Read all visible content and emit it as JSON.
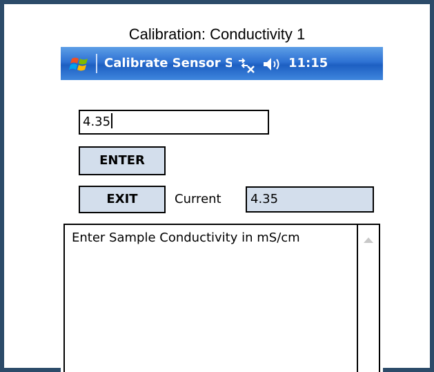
{
  "caption": "Calibration: Conductivity 1",
  "titlebar": {
    "start_icon": "windows-logo-icon",
    "title": "Calibrate Sensor S",
    "network_icon": "network-disconnected-icon",
    "speaker_icon": "speaker-icon",
    "time": "11:15",
    "colors": {
      "bar": "#2e72d3",
      "text": "#ffffff"
    }
  },
  "form": {
    "input_value": "4.35",
    "enter_label": "ENTER",
    "exit_label": "EXIT",
    "current_label": "Current",
    "current_value": "4.35",
    "button_color": "#d3deec"
  },
  "log": {
    "lines": [
      "Enter Sample Conductivity in mS/cm"
    ],
    "scroll_up_icon": "scroll-up-arrow-icon"
  },
  "frame_color": "#2c4b69"
}
